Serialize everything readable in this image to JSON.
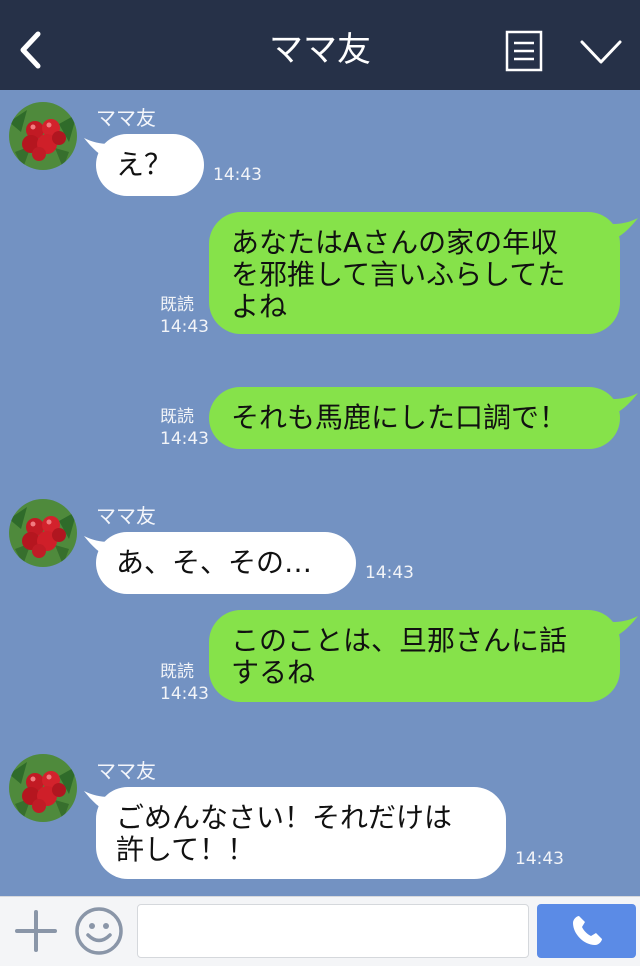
{
  "header": {
    "title": "ママ友",
    "back_icon": "chevron-left-icon",
    "menu_icon": "menu-icon",
    "expand_icon": "chevron-down-icon"
  },
  "messages": [
    {
      "side": "left",
      "sender": "ママ友",
      "lines": [
        "え？"
      ],
      "time": "14:43"
    },
    {
      "side": "right",
      "lines": [
        "あなたはAさんの家の年収",
        "を邪推して言いふらしてた",
        "よね"
      ],
      "read": "既読",
      "time": "14:43"
    },
    {
      "side": "right",
      "lines": [
        "それも馬鹿にした口調で！"
      ],
      "read": "既読",
      "time": "14:43"
    },
    {
      "side": "left",
      "sender": "ママ友",
      "lines": [
        "あ、そ、その…"
      ],
      "time": "14:43"
    },
    {
      "side": "right",
      "lines": [
        "このことは、旦那さんに話",
        "するね"
      ],
      "read": "既読",
      "time": "14:43"
    },
    {
      "side": "left",
      "sender": "ママ友",
      "lines": [
        "ごめんなさい！それだけは",
        "許して！！"
      ],
      "time": "14:43"
    }
  ],
  "footer": {
    "input_placeholder": "",
    "plus_icon": "plus-icon",
    "emoji_icon": "smiley-icon",
    "call_icon": "phone-icon"
  },
  "colors": {
    "header_bg": "#263148",
    "chat_bg": "#7392c2",
    "own_bubble": "#86e24a",
    "other_bubble": "#ffffff",
    "call_button": "#5b8be6"
  }
}
